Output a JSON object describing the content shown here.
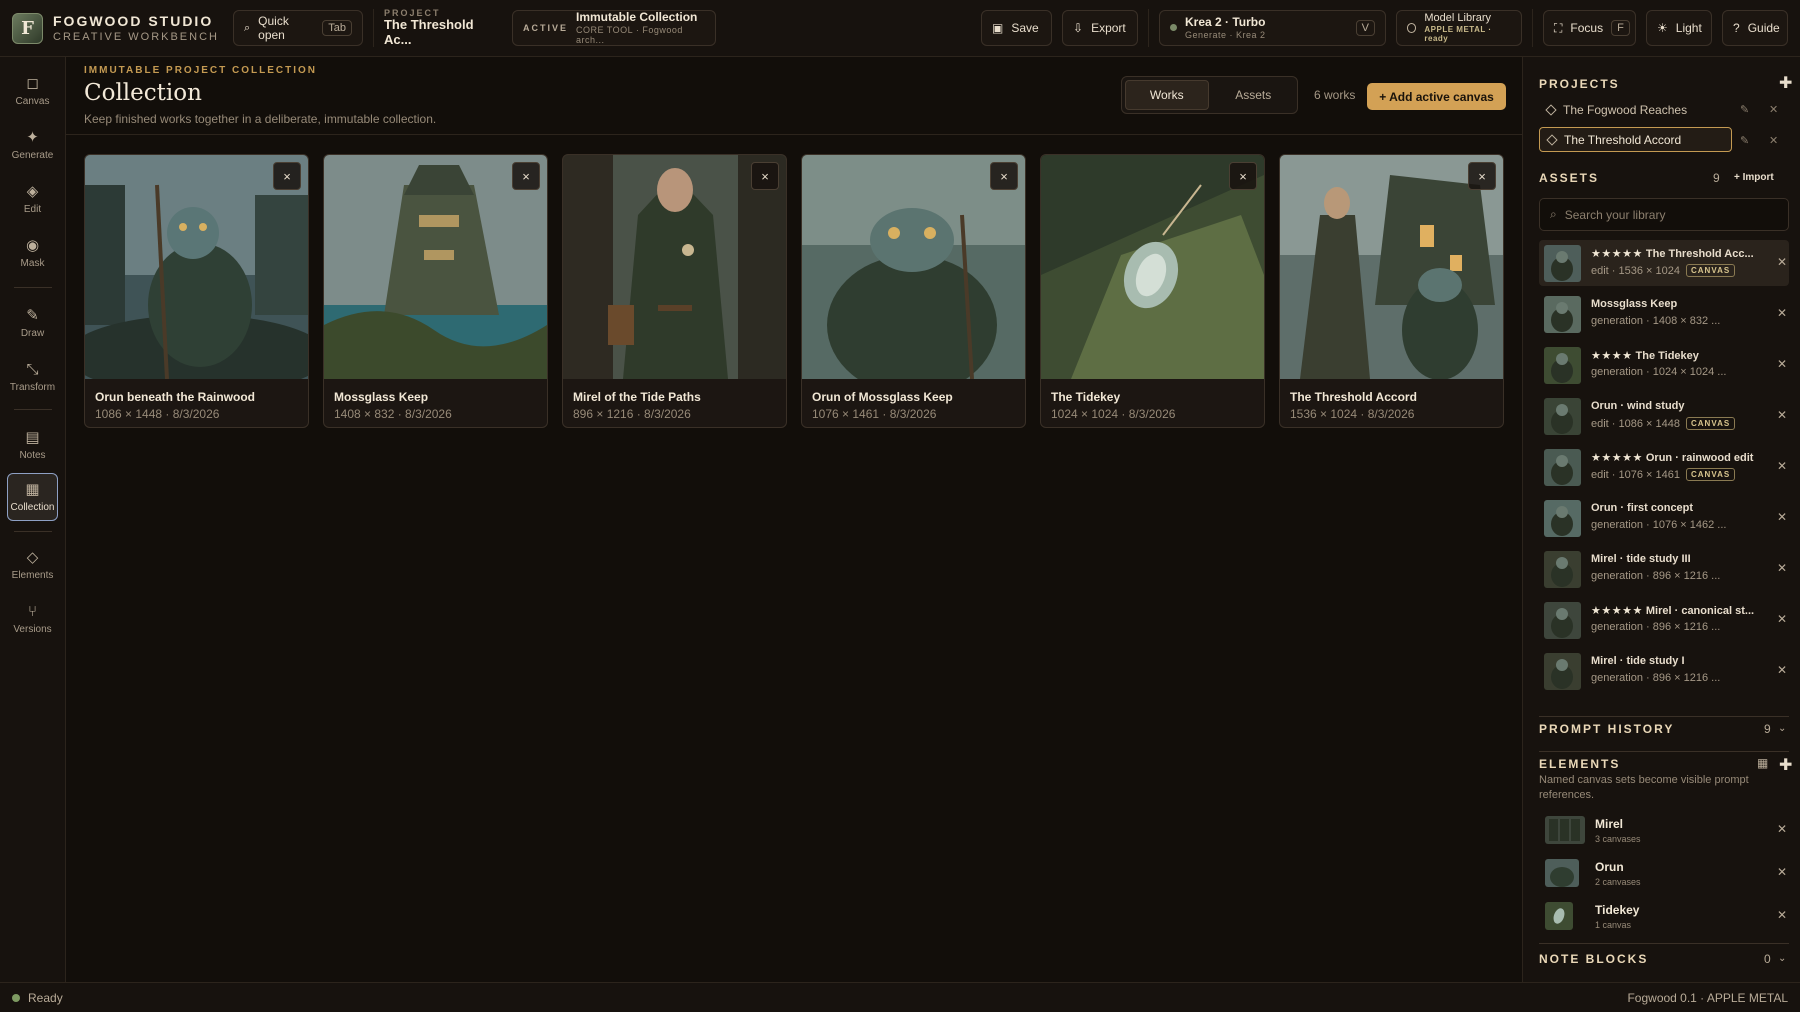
{
  "brand": {
    "name": "FOGWOOD STUDIO",
    "subtitle": "CREATIVE WORKBENCH",
    "logo_letter": "F"
  },
  "topbar": {
    "quick_open": {
      "label": "Quick open",
      "key": "Tab",
      "icon": "search-icon"
    },
    "project": {
      "caption": "PROJECT",
      "name": "The Threshold Ac..."
    },
    "active_tool": {
      "tag": "ACTIVE",
      "title": "Immutable Collection",
      "sub": "CORE TOOL · Fogwood arch..."
    },
    "save_label": "Save",
    "export_label": "Export",
    "model": {
      "name": "Krea 2 · Turbo",
      "sub": "Generate · Krea 2",
      "key": "V"
    },
    "model_library": {
      "label": "Model Library",
      "sub": "APPLE METAL · ready"
    },
    "focus": {
      "label": "Focus",
      "key": "F"
    },
    "theme_label": "Light",
    "guide_label": "Guide"
  },
  "rail": [
    {
      "label": "Canvas",
      "icon": "square-icon"
    },
    {
      "label": "Generate",
      "icon": "sparkle-icon"
    },
    {
      "label": "Edit",
      "icon": "diamond-icon"
    },
    {
      "label": "Mask",
      "icon": "circle-icon"
    },
    {
      "label": "Draw",
      "icon": "pencil-icon"
    },
    {
      "label": "Transform",
      "icon": "transform-icon"
    },
    {
      "label": "Notes",
      "icon": "notes-icon"
    },
    {
      "label": "Collection",
      "icon": "grid-icon"
    },
    {
      "label": "Elements",
      "icon": "diamond-outline-icon"
    },
    {
      "label": "Versions",
      "icon": "branch-icon"
    }
  ],
  "main": {
    "eyebrow": "IMMUTABLE PROJECT COLLECTION",
    "title": "Collection",
    "description": "Keep finished works together in a deliberate, immutable collection.",
    "tabs": [
      {
        "label": "Works",
        "active": true
      },
      {
        "label": "Assets",
        "active": false
      }
    ],
    "works_count": "6 works",
    "add_button": "+ Add active canvas",
    "remove_glyph": "×",
    "works": [
      {
        "title": "Orun beneath the Rainwood",
        "meta": "1086 × 1448 · 8/3/2026"
      },
      {
        "title": "Mossglass Keep",
        "meta": "1408 × 832 · 8/3/2026"
      },
      {
        "title": "Mirel of the Tide Paths",
        "meta": "896 × 1216 · 8/3/2026"
      },
      {
        "title": "Orun of Mossglass Keep",
        "meta": "1076 × 1461 · 8/3/2026"
      },
      {
        "title": "The Tidekey",
        "meta": "1024 × 1024 · 8/3/2026"
      },
      {
        "title": "The Threshold Accord",
        "meta": "1536 × 1024 · 8/3/2026"
      }
    ]
  },
  "panel": {
    "projects_title": "PROJECTS",
    "projects": [
      {
        "name": "The Fogwood Reaches",
        "selected": false
      },
      {
        "name": "The Threshold Accord",
        "selected": true
      }
    ],
    "assets_title": "ASSETS",
    "assets_count": "9",
    "import_label": "+ Import",
    "search_placeholder": "Search your library",
    "assets": [
      {
        "stars": "★★★★★",
        "title": "The Threshold Acc...",
        "meta": "edit · 1536 × 1024",
        "tag": "CANVAS",
        "selected": true
      },
      {
        "stars": "",
        "title": "Mossglass Keep",
        "meta": "generation · 1408 × 832 ...",
        "tag": ""
      },
      {
        "stars": "★★★★",
        "title": "The Tidekey",
        "meta": "generation · 1024 × 1024 ...",
        "tag": ""
      },
      {
        "stars": "",
        "title": "Orun · wind study",
        "meta": "edit · 1086 × 1448",
        "tag": "CANVAS"
      },
      {
        "stars": "★★★★★",
        "title": "Orun · rainwood edit",
        "meta": "edit · 1076 × 1461",
        "tag": "CANVAS"
      },
      {
        "stars": "",
        "title": "Orun · first concept",
        "meta": "generation · 1076 × 1462 ...",
        "tag": ""
      },
      {
        "stars": "",
        "title": "Mirel · tide study III",
        "meta": "generation · 896 × 1216 ...",
        "tag": ""
      },
      {
        "stars": "★★★★★",
        "title": "Mirel · canonical st...",
        "meta": "generation · 896 × 1216 ...",
        "tag": ""
      },
      {
        "stars": "",
        "title": "Mirel · tide study I",
        "meta": "generation · 896 × 1216 ...",
        "tag": ""
      }
    ],
    "prompt_history_title": "PROMPT HISTORY",
    "prompt_history_count": "9",
    "elements_title": "ELEMENTS",
    "elements_desc": "Named canvas sets become visible prompt references.",
    "elements": [
      {
        "name": "Mirel",
        "count": "3 canvases"
      },
      {
        "name": "Orun",
        "count": "2 canvases"
      },
      {
        "name": "Tidekey",
        "count": "1 canvas"
      }
    ],
    "note_blocks_title": "NOTE BLOCKS",
    "note_blocks_count": "0"
  },
  "status": {
    "state": "Ready",
    "version": "Fogwood 0.1 · APPLE METAL"
  },
  "colors": {
    "accent": "#d3a155",
    "selected_outline": "#8ea0c4",
    "background": "#14100c"
  }
}
